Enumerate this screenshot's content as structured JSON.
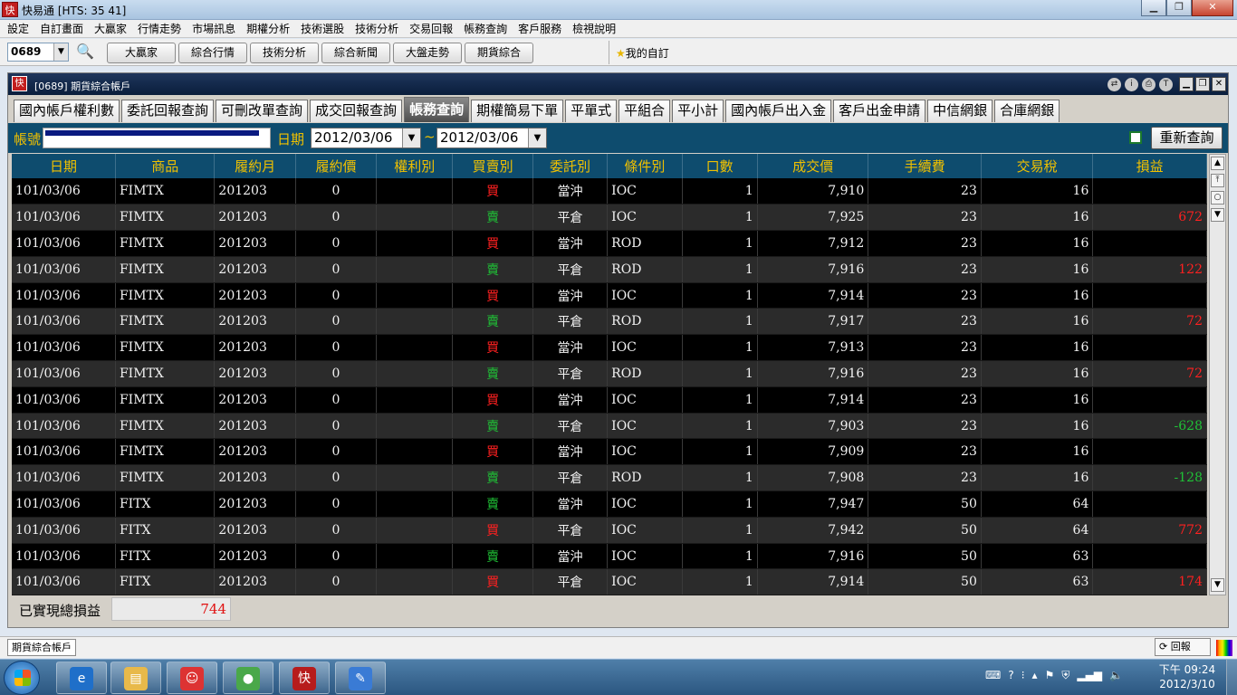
{
  "window": {
    "title": "快易通 [HTS: 35 41]",
    "app_icon_text": "快"
  },
  "menu": [
    "設定",
    "自訂畫面",
    "大贏家",
    "行情走勢",
    "市場訊息",
    "期權分析",
    "技術選股",
    "技術分析",
    "交易回報",
    "帳務查詢",
    "客戶服務",
    "檢視說明"
  ],
  "toolbar": {
    "stock_code": "0689",
    "buttons": [
      "大贏家",
      "綜合行情",
      "技術分析",
      "綜合新聞",
      "大盤走勢",
      "期貨綜合"
    ],
    "favorites_label": "我的自訂"
  },
  "inner_window": {
    "title": "[0689] 期貨綜合帳戶",
    "tabs": [
      "國內帳戶權利數",
      "委託回報查詢",
      "可刪改單查詢",
      "成交回報查詢",
      "帳務查詢",
      "期權簡易下單",
      "平單式",
      "平組合",
      "平小計",
      "國內帳戶出入金",
      "客戶出金申請",
      "中信網銀",
      "合庫網銀"
    ],
    "active_tab_index": 4
  },
  "query": {
    "account_label": "帳號",
    "date_label": "日期",
    "date_from": "2012/03/06",
    "date_to": "2012/03/06",
    "separator": "~",
    "requery_label": "重新查詢"
  },
  "table": {
    "columns": [
      "日期",
      "商品",
      "履約月",
      "履約價",
      "權利別",
      "買賣別",
      "委託別",
      "條件別",
      "口數",
      "成交價",
      "手續費",
      "交易稅",
      "損益"
    ],
    "rows": [
      [
        "101/03/06",
        "FIMTX",
        "201203",
        "0",
        "",
        "買",
        "當沖",
        "IOC",
        "1",
        "7,910",
        "23",
        "16",
        ""
      ],
      [
        "101/03/06",
        "FIMTX",
        "201203",
        "0",
        "",
        "賣",
        "平倉",
        "IOC",
        "1",
        "7,925",
        "23",
        "16",
        "672"
      ],
      [
        "101/03/06",
        "FIMTX",
        "201203",
        "0",
        "",
        "買",
        "當沖",
        "ROD",
        "1",
        "7,912",
        "23",
        "16",
        ""
      ],
      [
        "101/03/06",
        "FIMTX",
        "201203",
        "0",
        "",
        "賣",
        "平倉",
        "ROD",
        "1",
        "7,916",
        "23",
        "16",
        "122"
      ],
      [
        "101/03/06",
        "FIMTX",
        "201203",
        "0",
        "",
        "買",
        "當沖",
        "IOC",
        "1",
        "7,914",
        "23",
        "16",
        ""
      ],
      [
        "101/03/06",
        "FIMTX",
        "201203",
        "0",
        "",
        "賣",
        "平倉",
        "ROD",
        "1",
        "7,917",
        "23",
        "16",
        "72"
      ],
      [
        "101/03/06",
        "FIMTX",
        "201203",
        "0",
        "",
        "買",
        "當沖",
        "IOC",
        "1",
        "7,913",
        "23",
        "16",
        ""
      ],
      [
        "101/03/06",
        "FIMTX",
        "201203",
        "0",
        "",
        "賣",
        "平倉",
        "ROD",
        "1",
        "7,916",
        "23",
        "16",
        "72"
      ],
      [
        "101/03/06",
        "FIMTX",
        "201203",
        "0",
        "",
        "買",
        "當沖",
        "IOC",
        "1",
        "7,914",
        "23",
        "16",
        ""
      ],
      [
        "101/03/06",
        "FIMTX",
        "201203",
        "0",
        "",
        "賣",
        "平倉",
        "IOC",
        "1",
        "7,903",
        "23",
        "16",
        "-628"
      ],
      [
        "101/03/06",
        "FIMTX",
        "201203",
        "0",
        "",
        "買",
        "當沖",
        "IOC",
        "1",
        "7,909",
        "23",
        "16",
        ""
      ],
      [
        "101/03/06",
        "FIMTX",
        "201203",
        "0",
        "",
        "賣",
        "平倉",
        "ROD",
        "1",
        "7,908",
        "23",
        "16",
        "-128"
      ],
      [
        "101/03/06",
        "FITX",
        "201203",
        "0",
        "",
        "賣",
        "當沖",
        "IOC",
        "1",
        "7,947",
        "50",
        "64",
        ""
      ],
      [
        "101/03/06",
        "FITX",
        "201203",
        "0",
        "",
        "買",
        "平倉",
        "IOC",
        "1",
        "7,942",
        "50",
        "64",
        "772"
      ],
      [
        "101/03/06",
        "FITX",
        "201203",
        "0",
        "",
        "賣",
        "當沖",
        "IOC",
        "1",
        "7,916",
        "50",
        "63",
        ""
      ],
      [
        "101/03/06",
        "FITX",
        "201203",
        "0",
        "",
        "買",
        "平倉",
        "IOC",
        "1",
        "7,914",
        "50",
        "63",
        "174"
      ]
    ]
  },
  "summary": {
    "label": "已實現總損益",
    "value": "744"
  },
  "statusbar": {
    "task_label": "期貨綜合帳戶",
    "report_label": "回報"
  },
  "taskbar": {
    "time": "下午 09:24",
    "date": "2012/3/10"
  },
  "colors": {
    "buy": "#ff2020",
    "sell": "#1fc236",
    "header_bg": "#0e4c6e",
    "header_text": "#f0c000"
  }
}
